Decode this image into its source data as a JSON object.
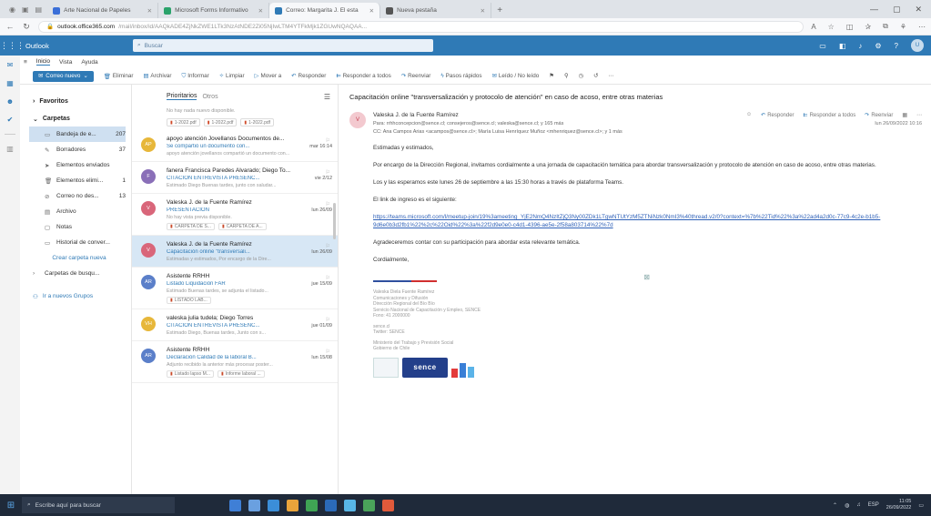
{
  "browser": {
    "tabs": [
      {
        "title": "Arte Nacional de Papeles",
        "active": false,
        "color": "#3b6fd8"
      },
      {
        "title": "Microsoft Forms Informativo",
        "active": false,
        "color": "#2ba36b"
      },
      {
        "title": "Correo: Margarita J. El esta",
        "active": true,
        "color": "#2f7ab6"
      },
      {
        "title": "Nueva pestaña",
        "active": false,
        "color": "#555555"
      }
    ],
    "url_host": "outlook.office365.com",
    "url_rest": "/mail/inbox/id/AAQkADE4ZjNkZWE1LTk3NzAtNDE2Zi05NjIwLTM4YTFkMjk1ZGUwNQAQAA..."
  },
  "outlook": {
    "brand": "Outlook",
    "search_placeholder": "Buscar",
    "ribbon_tabs": [
      "Inicio",
      "Vista",
      "Ayuda"
    ],
    "new_mail": "Correo nuevo",
    "ribbon_items": [
      "Eliminar",
      "Archivar",
      "Informar",
      "Limpiar",
      "Mover a",
      "Responder",
      "Responder a todos",
      "Reenviar",
      "Pasos rápidos",
      "Leído / No leído"
    ]
  },
  "folders": {
    "favorites_label": "Favoritos",
    "folders_label": "Carpetas",
    "items": [
      {
        "label": "Bandeja de e...",
        "count": "207",
        "icon": "inbox-icon",
        "selected": true
      },
      {
        "label": "Borradores",
        "count": "37",
        "icon": "draft-icon",
        "selected": false
      },
      {
        "label": "Elementos enviados",
        "count": "",
        "icon": "sent-icon",
        "selected": false
      },
      {
        "label": "Elementos elimi...",
        "count": "1",
        "icon": "trash-icon",
        "selected": false
      },
      {
        "label": "Correo no des...",
        "count": "13",
        "icon": "junk-icon",
        "selected": false
      },
      {
        "label": "Archivo",
        "count": "",
        "icon": "archive-icon",
        "selected": false
      },
      {
        "label": "Notas",
        "count": "",
        "icon": "notes-icon",
        "selected": false
      },
      {
        "label": "Historial de conver...",
        "count": "",
        "icon": "history-icon",
        "selected": false
      }
    ],
    "create_folder": "Crear carpeta nueva",
    "search_folders": "Carpetas de busqu...",
    "new_group": "Ir a nuevos Grupos"
  },
  "msglist": {
    "tab_focused": "Prioritarios",
    "tab_other": "Otros",
    "note": "No hay nada nuevo disponible.",
    "attachments": [
      "1-2022.pdf",
      "1-2022.pdf",
      "1-2022.pdf"
    ],
    "messages": [
      {
        "initials": "AP",
        "avatar_color": "#e7b73a",
        "sender": "apoyo atención Jovellanos Documentos de...",
        "subject": "Se compartió un documento con...",
        "date": "mar 16:14",
        "preview": "apoyo atención jovellanos compartió un documento con...",
        "chips": [],
        "selected": false
      },
      {
        "initials": "F",
        "avatar_color": "#8a6fb8",
        "sender": "fanera Francisca Paredes Alvarado; Diego To...",
        "subject": "CITACIÓN ENTREVISTA PRESENC...",
        "date": "vie 2/12",
        "preview": "Estimado Diego Buenas tardes, junto con saludar...",
        "chips": [],
        "selected": false
      },
      {
        "initials": "V",
        "avatar_color": "#d9667a",
        "sender": "Valeska J. de la Fuente Ramírez",
        "subject": "PRESENTACIÓN",
        "date": "lun 26/09",
        "preview": "No hay vista previa disponible.",
        "chips": [
          "CARPETA DE S...",
          "CARPETA DE A..."
        ],
        "selected": false
      },
      {
        "initials": "V",
        "avatar_color": "#d9667a",
        "sender": "Valeska J. de la Fuente Ramírez",
        "subject": "Capacitación online \"transversali...",
        "date": "lun 26/09",
        "preview": "Estimadas y estimados, Por encargo de la Dire...",
        "chips": [],
        "selected": true
      },
      {
        "initials": "AR",
        "avatar_color": "#5b7fc9",
        "sender": "Asistente RRHH",
        "subject": "Listado Liquidación FAR",
        "date": "jue 15/09",
        "preview": "Estimado Buenas tardes, se adjunta el listado...",
        "chips": [
          "LISTADO LAB..."
        ],
        "selected": false
      },
      {
        "initials": "VH",
        "avatar_color": "#e7b73a",
        "sender": "valeska julia tudela; Diego Torres",
        "subject": "CITACIÓN ENTREVISTA PRESENC...",
        "date": "jue 01/09",
        "preview": "Estimado Diego, Buenas tardes, Junto con s...",
        "chips": [],
        "selected": false
      },
      {
        "initials": "AR",
        "avatar_color": "#5b7fc9",
        "sender": "Asistente RRHH",
        "subject": "Declaración Calidad de la laboral B...",
        "date": "lun 15/08",
        "preview": "Adjunto recibido la anterior más procesar poster...",
        "chips": [
          "Listado lapso M...",
          "Informe laboral ..."
        ],
        "selected": false
      }
    ]
  },
  "reading": {
    "subject": "Capacitación online \"transversalización y protocolo de atención\" en caso de acoso, entre otras materias",
    "avatar_initials": "V",
    "sender": "Valeska J. de la Fuente Ramírez",
    "actions": [
      "Responder",
      "Responder a todos",
      "Reenviar"
    ],
    "to": "Para: rrhhconcepcion@sence.cl; consejeros@sence.cl; valeska@sence.cl; y 165 más",
    "date": "lun 26/09/2022 10:16",
    "cc": "CC: Ana Campos Arias <acampos@sence.cl>; María Luisa Henríquez Muñoz <mhenriquez@sence.cl>; y 1 más",
    "greeting": "Estimadas y estimados,",
    "para1": "Por encargo de la Dirección Regional, invitamos cordialmente a una jornada de capacitación temática para abordar transversalización y protocolo de atención en caso de acoso, entre otras materias.",
    "para2": "Los y las esperamos este lunes 26 de septiembre a las 15:30 horas a través de plataforma Teams.",
    "para3": "El link de ingreso es el siguiente:",
    "link": "https://teams.microsoft.com/l/meetup-join/19%3ameeting_YjE2NmQ4NzItZjQ3Ny00ZDk1LTgwNTUtYzM5ZTNiNzk0NmI3%40thread.v2/0?context=%7b%22Tid%22%3a%22ad4a2d0c-77c9-4c2e-b1b5-9d6e0b3d2fb1%22%2c%22Oid%22%3a%22f2d9e0e0-c4d1-4396-ae5e-2f58a803714%22%7d",
    "para4": "Agradeceremos contar con su participación para abordar esta relevante temática.",
    "closing": "Cordialmente,",
    "signature": {
      "name": "Valeska Diela Fuente Ramírez",
      "lines": [
        "Comunicaciones y Difusión",
        "Dirección Regional del Bío Bío",
        "Servicio Nacional de Capacitación y Empleo, SENCE",
        "Fono: 41 2000000"
      ],
      "extra": [
        "sence.cl",
        "Twitter: SENCE"
      ],
      "ministry": [
        "Ministerio del Trabajo y Previsión Social",
        "Gobierno de Chile"
      ],
      "logo_text": "sence"
    }
  },
  "taskbar": {
    "search_placeholder": "Escribe aquí para buscar",
    "time": "11:05",
    "date": "26/09/2022",
    "apps": [
      "#3f7fd6",
      "#6aa0e0",
      "#3b8ed8",
      "#e9a43b",
      "#3fa454",
      "#2b6ab8",
      "#58b6e6",
      "#4aa35a",
      "#e05a3b"
    ]
  }
}
